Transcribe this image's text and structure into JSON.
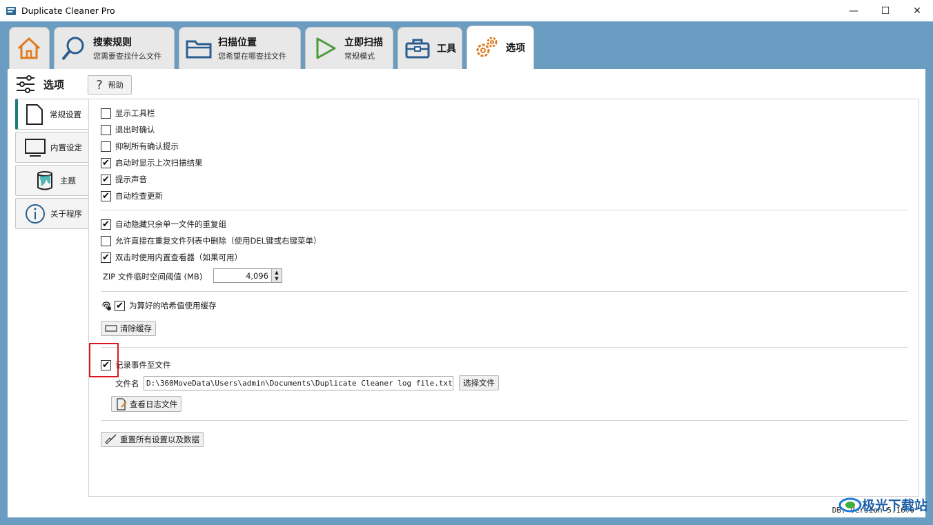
{
  "window": {
    "title": "Duplicate Cleaner Pro",
    "minimize": "—",
    "maximize": "☐",
    "close": "✕"
  },
  "tabs": [
    {
      "main": "",
      "sub": "",
      "icon": "home-icon"
    },
    {
      "main": "搜索规则",
      "sub": "您需要查找什么文件",
      "icon": "search-icon"
    },
    {
      "main": "扫描位置",
      "sub": "您希望在哪查找文件",
      "icon": "folder-icon"
    },
    {
      "main": "立即扫描",
      "sub": "常规模式",
      "icon": "play-icon"
    },
    {
      "main": "工具",
      "sub": "",
      "icon": "toolbox-icon"
    },
    {
      "main": "选项",
      "sub": "",
      "icon": "gears-icon"
    }
  ],
  "header": {
    "title": "选项",
    "help": "帮助"
  },
  "sidenav": [
    {
      "label": "常规设置",
      "icon": "document-icon"
    },
    {
      "label": "内置设定",
      "icon": "monitor-icon"
    },
    {
      "label": "主题",
      "icon": "paint-bucket-icon"
    },
    {
      "label": "关于程序",
      "icon": "info-icon"
    }
  ],
  "options": {
    "show_toolbar": {
      "label": "显示工具栏",
      "checked": false
    },
    "confirm_exit": {
      "label": "退出时确认",
      "checked": false
    },
    "suppress_confirm": {
      "label": "抑制所有确认提示",
      "checked": false
    },
    "show_last_scan": {
      "label": "启动时显示上次扫描结果",
      "checked": true
    },
    "sound": {
      "label": "提示声音",
      "checked": true
    },
    "auto_update": {
      "label": "自动检查更新",
      "checked": true
    },
    "auto_hide": {
      "label": "自动隐藏只余单一文件的重复组",
      "checked": true
    },
    "allow_delete": {
      "label": "允许直接在重复文件列表中删除（使用DEL键或右键菜单）",
      "checked": false
    },
    "builtin_viewer": {
      "label": "双击时使用内置查看器（如果可用）",
      "checked": true
    },
    "zip_label": "ZIP 文件临时空间阈值 (MB)",
    "zip_value": "4,096",
    "hash_cache": {
      "label": "为算好的哈希值使用缓存",
      "checked": true
    },
    "clear_cache": "清除缓存",
    "log_events": {
      "label": "记录事件至文件",
      "checked": true
    },
    "filename_label": "文件名",
    "filename_value": "D:\\360MoveData\\Users\\admin\\Documents\\Duplicate Cleaner log file.txt",
    "choose_file": "选择文件",
    "view_log": "查看日志文件",
    "reset_all": "重置所有设置以及数据"
  },
  "status": {
    "text": "DB:    Version 5.16.0"
  },
  "watermark": {
    "text": "极光下载站"
  },
  "colors": {
    "accent": "#1f7a7a",
    "background": "#6b9dc2",
    "highlight": "#e0141e"
  }
}
